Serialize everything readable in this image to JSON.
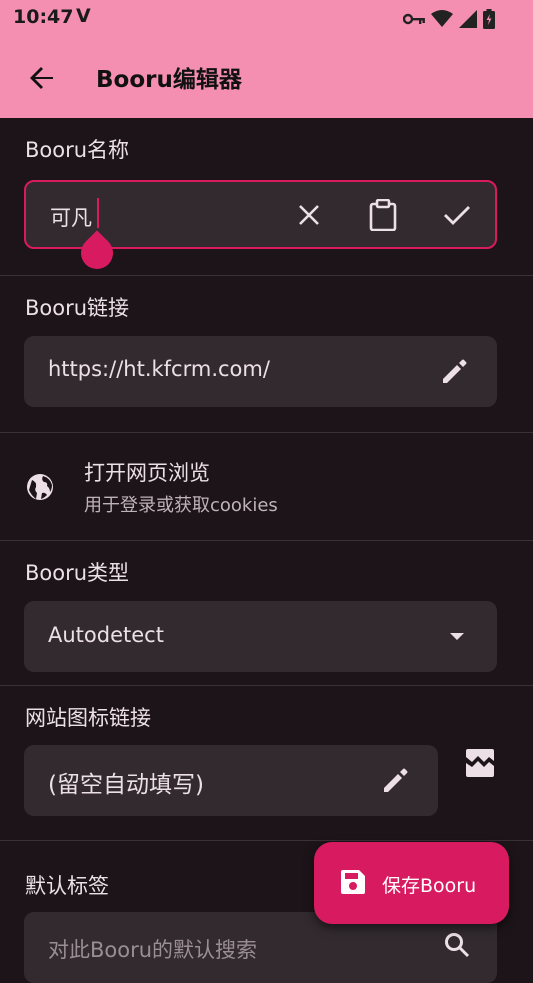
{
  "status": {
    "time": "10:47",
    "app_icon": "V"
  },
  "header": {
    "title": "Booru编辑器"
  },
  "fields": {
    "name": {
      "label": "Booru名称",
      "value": "可凡"
    },
    "url": {
      "label": "Booru链接",
      "value": "https://ht.kfcrm.com/"
    },
    "browser": {
      "title": "打开网页浏览",
      "subtitle": "用于登录或获取cookies"
    },
    "type": {
      "label": "Booru类型",
      "value": "Autodetect"
    },
    "favicon": {
      "label": "网站图标链接",
      "placeholder": "(留空自动填写)"
    },
    "default_tags": {
      "label": "默认标签",
      "placeholder": "对此Booru的默认搜索"
    }
  },
  "fab": {
    "label": "保存Booru"
  },
  "colors": {
    "accent": "#d81b60",
    "appbar": "#f48fb1",
    "background": "#1c1418",
    "field": "#322a2e"
  }
}
